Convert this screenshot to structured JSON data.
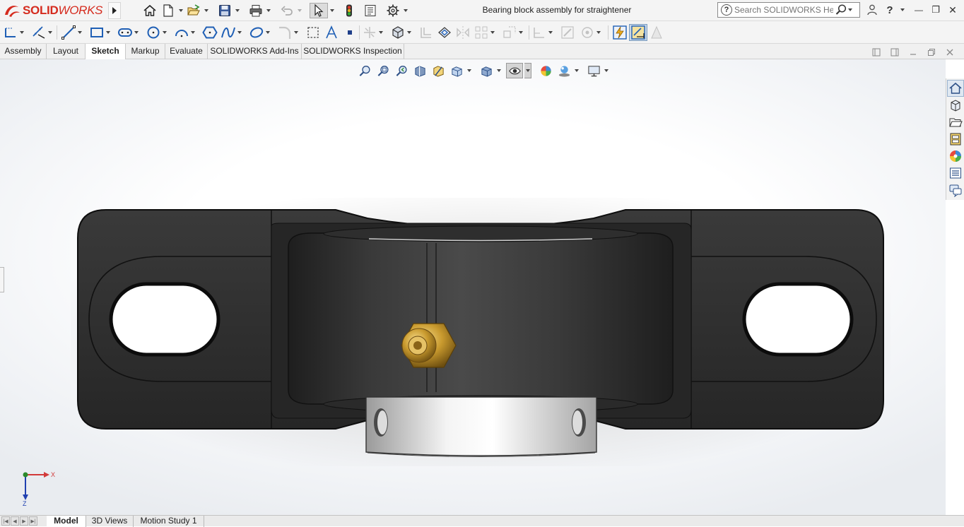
{
  "app": {
    "logo_ds": "3DS",
    "logo_solid": "SOLID",
    "logo_works": "WORKS",
    "document_title": "Bearing block assembly for straightener"
  },
  "quick_access": [
    {
      "icon": "home-icon"
    },
    {
      "icon": "new-document-icon"
    },
    {
      "icon": "open-icon"
    },
    {
      "icon": "save-icon"
    },
    {
      "icon": "print-icon"
    },
    {
      "icon": "undo-icon"
    },
    {
      "icon": "select-icon"
    },
    {
      "icon": "rebuild-icon"
    },
    {
      "icon": "file-properties-icon"
    },
    {
      "icon": "options-gear-icon"
    }
  ],
  "search": {
    "placeholder": "Search SOLIDWORKS Help",
    "help_glyph": "?"
  },
  "window_controls": {
    "user": "user-icon",
    "help": "?",
    "minimize": "—",
    "restore": "❐",
    "close": "✕"
  },
  "command_tabs": [
    {
      "label": "Assembly"
    },
    {
      "label": "Layout"
    },
    {
      "label": "Sketch",
      "active": true
    },
    {
      "label": "Markup"
    },
    {
      "label": "Evaluate"
    },
    {
      "label": "SOLIDWORKS Add-Ins"
    },
    {
      "label": "SOLIDWORKS Inspection"
    }
  ],
  "sketch_tools": [
    "sketch-icon",
    "smart-dimension-icon",
    "line-icon",
    "rectangle-icon",
    "slot-icon",
    "circle-icon",
    "arc-icon",
    "polygon-icon",
    "spline-icon",
    "ellipse-icon",
    "fillet-icon",
    "construction-geometry-icon",
    "text-icon",
    "point-icon",
    "trim-entities-icon",
    "convert-entities-icon",
    "offset-entities-icon",
    "offset-on-surface-icon",
    "mirror-entities-icon",
    "linear-pattern-icon",
    "move-entities-icon",
    "display-relations-icon",
    "repair-sketch-icon",
    "quick-snaps-icon",
    "rapid-sketch-icon",
    "instant2d-icon",
    "shaded-contours-icon"
  ],
  "heads_up_toolbar": [
    "zoom-to-fit-icon",
    "zoom-to-area-icon",
    "previous-view-icon",
    "section-view-icon",
    "dynamic-annotation-icon",
    "view-orientation-icon",
    "display-style-icon",
    "hide-show-items-icon",
    "edit-appearance-icon",
    "apply-scene-icon",
    "view-settings-icon"
  ],
  "task_pane": [
    "solidworks-resources-icon",
    "design-library-icon",
    "file-explorer-icon",
    "view-palette-icon",
    "appearances-scenes-icon",
    "custom-properties-icon",
    "solidworks-forum-icon"
  ],
  "triad": {
    "x_label": "X",
    "y_label": "Z"
  },
  "bottom_tabs": [
    {
      "label": "Model",
      "active": true
    },
    {
      "label": "3D Views"
    },
    {
      "label": "Motion Study 1"
    }
  ],
  "colors": {
    "brand_red": "#d52b1e",
    "housing": "#2b2b2b",
    "grease_nipple": "#b8902a",
    "insert_ring": "#d9d9d9",
    "triad_x": "#d23a3a",
    "triad_y": "#2a8a2a",
    "triad_z": "#2040b0"
  }
}
